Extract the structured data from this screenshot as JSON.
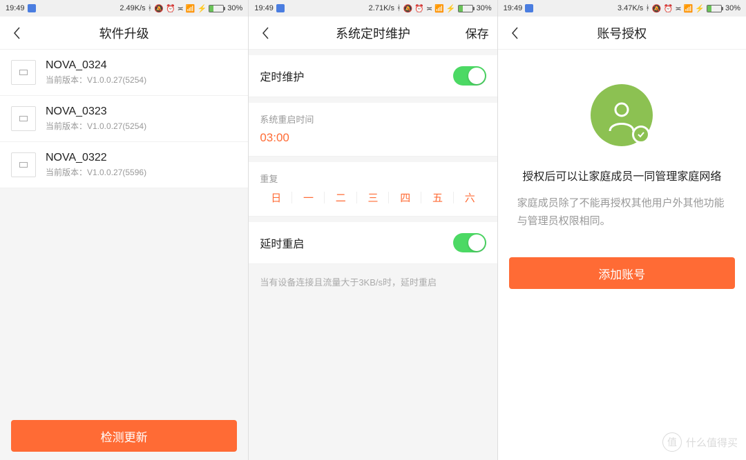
{
  "status": {
    "time": "19:49",
    "speed1": "2.49K/s",
    "speed2": "2.71K/s",
    "speed3": "3.47K/s",
    "battery": "30%"
  },
  "screen1": {
    "title": "软件升级",
    "devices": [
      {
        "name": "NOVA_0324",
        "version": "当前版本：V1.0.0.27(5254)"
      },
      {
        "name": "NOVA_0323",
        "version": "当前版本：V1.0.0.27(5254)"
      },
      {
        "name": "NOVA_0322",
        "version": "当前版本：V1.0.0.27(5596)"
      }
    ],
    "check_button": "检测更新"
  },
  "screen2": {
    "title": "系统定时维护",
    "save": "保存",
    "scheduled_maint": "定时维护",
    "reboot_time_label": "系统重启时间",
    "reboot_time": "03:00",
    "repeat_label": "重复",
    "weekdays": [
      "日",
      "一",
      "二",
      "三",
      "四",
      "五",
      "六"
    ],
    "delayed_reboot": "延时重启",
    "note": "当有设备连接且流量大于3KB/s时，延时重启"
  },
  "screen3": {
    "title": "账号授权",
    "line1": "授权后可以让家庭成员一同管理家庭网络",
    "line2": "家庭成员除了不能再授权其他用户外其他功能与管理员权限相同。",
    "add_button": "添加账号"
  },
  "watermark": {
    "glyph": "值",
    "text": "什么值得买"
  }
}
